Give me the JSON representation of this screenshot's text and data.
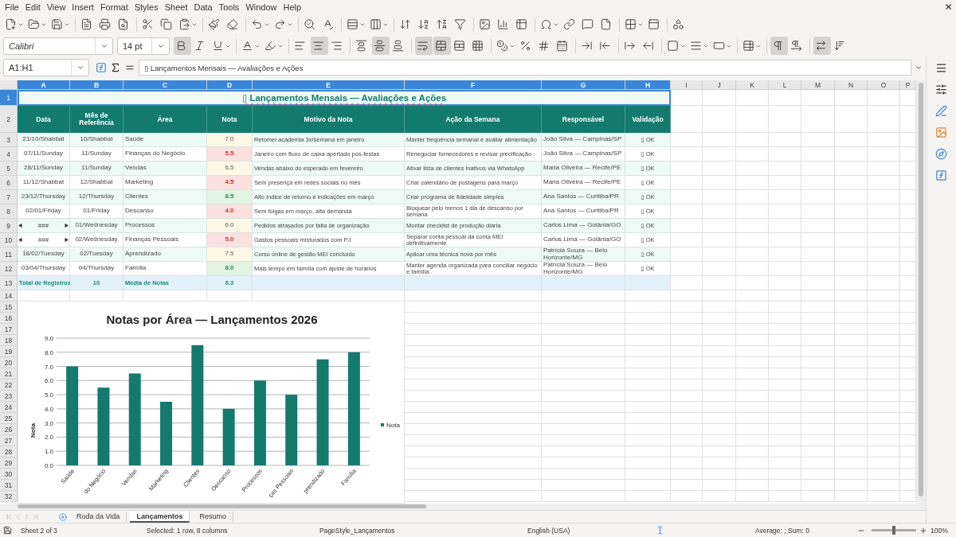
{
  "menu": [
    "File",
    "Edit",
    "View",
    "Insert",
    "Format",
    "Styles",
    "Sheet",
    "Data",
    "Tools",
    "Window",
    "Help"
  ],
  "format_bar": {
    "font": "Calibri",
    "size": "14 pt"
  },
  "format_state": {
    "bold": true,
    "italic": false,
    "underline": false,
    "align_left": false,
    "align_center": true,
    "align_right": false,
    "valign_top": false,
    "valign_center": true,
    "valign_bottom": false,
    "wrap": true,
    "merge": true,
    "ltr": true,
    "rtl": false,
    "text_ltr": true,
    "text_ttb": false
  },
  "formula_bar": {
    "cell": "A1:H1",
    "content": "▯ Lançamentos Mensais — Avaliações e Ações"
  },
  "columns": [
    {
      "label": "A",
      "selected": true
    },
    {
      "label": "B",
      "selected": true
    },
    {
      "label": "C",
      "selected": true
    },
    {
      "label": "D",
      "selected": true
    },
    {
      "label": "E",
      "selected": true
    },
    {
      "label": "F",
      "selected": true
    },
    {
      "label": "G",
      "selected": true
    },
    {
      "label": "H",
      "selected": true
    },
    {
      "label": "I",
      "selected": false
    },
    {
      "label": "J",
      "selected": false
    },
    {
      "label": "K",
      "selected": false
    },
    {
      "label": "L",
      "selected": false
    },
    {
      "label": "M",
      "selected": false
    },
    {
      "label": "N",
      "selected": false
    },
    {
      "label": "O",
      "selected": false
    },
    {
      "label": "P",
      "selected": false
    }
  ],
  "row_numbers": [
    {
      "label": "1",
      "selected": true
    },
    {
      "label": "2",
      "selected": false
    },
    {
      "label": "3",
      "selected": false
    },
    {
      "label": "4",
      "selected": false
    },
    {
      "label": "5",
      "selected": false
    },
    {
      "label": "6",
      "selected": false
    },
    {
      "label": "7",
      "selected": false
    },
    {
      "label": "8",
      "selected": false
    },
    {
      "label": "9",
      "selected": false
    },
    {
      "label": "10",
      "selected": false
    },
    {
      "label": "11",
      "selected": false
    },
    {
      "label": "12",
      "selected": false
    },
    {
      "label": "13",
      "selected": false
    },
    {
      "label": "14",
      "selected": false
    },
    {
      "label": "15",
      "selected": false
    },
    {
      "label": "16",
      "selected": false
    },
    {
      "label": "17",
      "selected": false
    },
    {
      "label": "18",
      "selected": false
    },
    {
      "label": "19",
      "selected": false
    },
    {
      "label": "20",
      "selected": false
    },
    {
      "label": "21",
      "selected": false
    },
    {
      "label": "22",
      "selected": false
    },
    {
      "label": "23",
      "selected": false
    },
    {
      "label": "24",
      "selected": false
    },
    {
      "label": "25",
      "selected": false
    },
    {
      "label": "26",
      "selected": false
    },
    {
      "label": "27",
      "selected": false
    },
    {
      "label": "28",
      "selected": false
    },
    {
      "label": "29",
      "selected": false
    },
    {
      "label": "30",
      "selected": false
    },
    {
      "label": "31",
      "selected": false
    },
    {
      "label": "32",
      "selected": false
    }
  ],
  "sheet": {
    "title": "▯ Lançamentos Mensais — Avaliações e Ações",
    "headers": [
      "Data",
      "Mês de Referência",
      "Área",
      "Nota",
      "Motivo da Nota",
      "Ação da Semana",
      "Responsável",
      "Validação"
    ],
    "rows": [
      {
        "cells": [
          "21/10/Shabbat",
          "10/Shabbat",
          "Saúde",
          "7.0",
          "Retomei academia 3x/semana em janeiro",
          "Manter frequência semanal e avaliar alimentação",
          "João Silva — Campinas/SP",
          "▯ OK"
        ],
        "kind": "mid",
        "clipped": false
      },
      {
        "cells": [
          "07/11/Sunday",
          "11/Sunday",
          "Finanças do Negócio",
          "5.5",
          "Janeiro com fluxo de caixa apertado pós-festas",
          "Renegociar fornecedores e revisar precificação",
          "João Silva — Campinas/SP",
          "▯ OK"
        ],
        "kind": "low",
        "clipped": false
      },
      {
        "cells": [
          "28/11/Sunday",
          "11/Sunday",
          "Vendas",
          "6.5",
          "Vendas abaixo do esperado em fevereiro",
          "Ativar lista de clientes inativos via WhatsApp",
          "Maria Oliveira — Recife/PE",
          "▯ OK"
        ],
        "kind": "mid",
        "clipped": false
      },
      {
        "cells": [
          "11/12/Shabbat",
          "12/Shabbat",
          "Marketing",
          "4.5",
          "Sem presença em redes sociais no mês",
          "Criar calendário de postagens para março",
          "Maria Oliveira — Recife/PE",
          "▯ OK"
        ],
        "kind": "low",
        "clipped": false
      },
      {
        "cells": [
          "23/12/Thursday",
          "12/Thursday",
          "Clientes",
          "8.5",
          "Alto índice de retorno e indicações em março",
          "Criar programa de fidelidade simples",
          "Ana Santos — Curitiba/PR",
          "▯ OK"
        ],
        "kind": "high",
        "clipped": false
      },
      {
        "cells": [
          "02/01/Friday",
          "01/Friday",
          "Descanso",
          "4.0",
          "Sem folgas em março, alta demanda",
          "Bloquear pelo menos 1 dia de descanso por semana",
          "Ana Santos — Curitiba/PR",
          "▯ OK"
        ],
        "kind": "low",
        "clipped": false
      },
      {
        "cells": [
          "###",
          "01/Wednesday",
          "Processos",
          "6.0",
          "Pedidos atrasados por falta de organização",
          "Montar checklist de produção diária",
          "Carlos Lima — Goiânia/GO",
          "▯ OK"
        ],
        "kind": "mid",
        "clipped": true
      },
      {
        "cells": [
          "###",
          "02/Wednesday",
          "Finanças Pessoais",
          "5.0",
          "Gastos pessoais misturados com PJ",
          "Separar conta pessoal da conta MEI definitivamente",
          "Carlos Lima — Goiânia/GO",
          "▯ OK"
        ],
        "kind": "low",
        "clipped": true
      },
      {
        "cells": [
          "18/02/Tuesday",
          "02/Tuesday",
          "Aprendizado",
          "7.5",
          "Curso online de gestão MEI concluído",
          "Aplicar uma técnica nova por mês",
          "Patrícia Souza — Belo Horizonte/MG",
          "▯ OK"
        ],
        "kind": "mid",
        "clipped": false
      },
      {
        "cells": [
          "03/04/Thursday",
          "04/Thursday",
          "Família",
          "8.0",
          "Mais tempo em família com ajuste de horários",
          "Manter agenda organizada para conciliar negócio e família",
          "Patrícia Souza — Belo Horizonte/MG",
          "▯ OK"
        ],
        "kind": "high",
        "clipped": false
      }
    ],
    "totals": [
      "Total de Registros",
      "10",
      "Média de Notas",
      "6.3"
    ]
  },
  "chart": {
    "chart_data": {
      "type": "bar",
      "grid": true,
      "title": "Notas por Área — Lançamentos 2026",
      "ylabel": "Nota",
      "categories": [
        "Saúde",
        "do Negócio",
        "Vendas",
        "Marketing",
        "Clientes",
        "Descanso",
        "Processos",
        "ças Pessoais",
        "prendizado",
        "Família"
      ],
      "series": [
        {
          "name": "Nota",
          "color": "#137a6e",
          "values": [
            7.0,
            5.5,
            6.5,
            4.5,
            8.5,
            4.0,
            6.0,
            5.0,
            7.5,
            8.0
          ]
        }
      ],
      "ylim": [
        0,
        9
      ],
      "yticks": [
        {
          "value": 0,
          "label": "0.0"
        },
        {
          "value": 1,
          "label": "1.0"
        },
        {
          "value": 2,
          "label": "2.0"
        },
        {
          "value": 3,
          "label": "3.0"
        },
        {
          "value": 4,
          "label": "4.0"
        },
        {
          "value": 5,
          "label": "5.0"
        },
        {
          "value": 6,
          "label": "6.0"
        },
        {
          "value": 7,
          "label": "7.0"
        },
        {
          "value": 8,
          "label": "8.0"
        },
        {
          "value": 9,
          "label": "9.0"
        }
      ]
    }
  },
  "sheet_tabs": [
    {
      "label": "Roda da Vida",
      "selected": false
    },
    {
      "label": "Lançamentos",
      "selected": true
    },
    {
      "label": "Resumo",
      "selected": false
    }
  ],
  "status_bar": {
    "sheet": "Sheet 2 of 3",
    "selection": "Selected: 1 row, 8 columns",
    "page_style": "PageStyle_Lançamentos",
    "language": "English (USA)",
    "sum": "Average: ; Sum: 0",
    "zoom": {
      "level": 0.5
    },
    "zoom_label": "100%"
  }
}
